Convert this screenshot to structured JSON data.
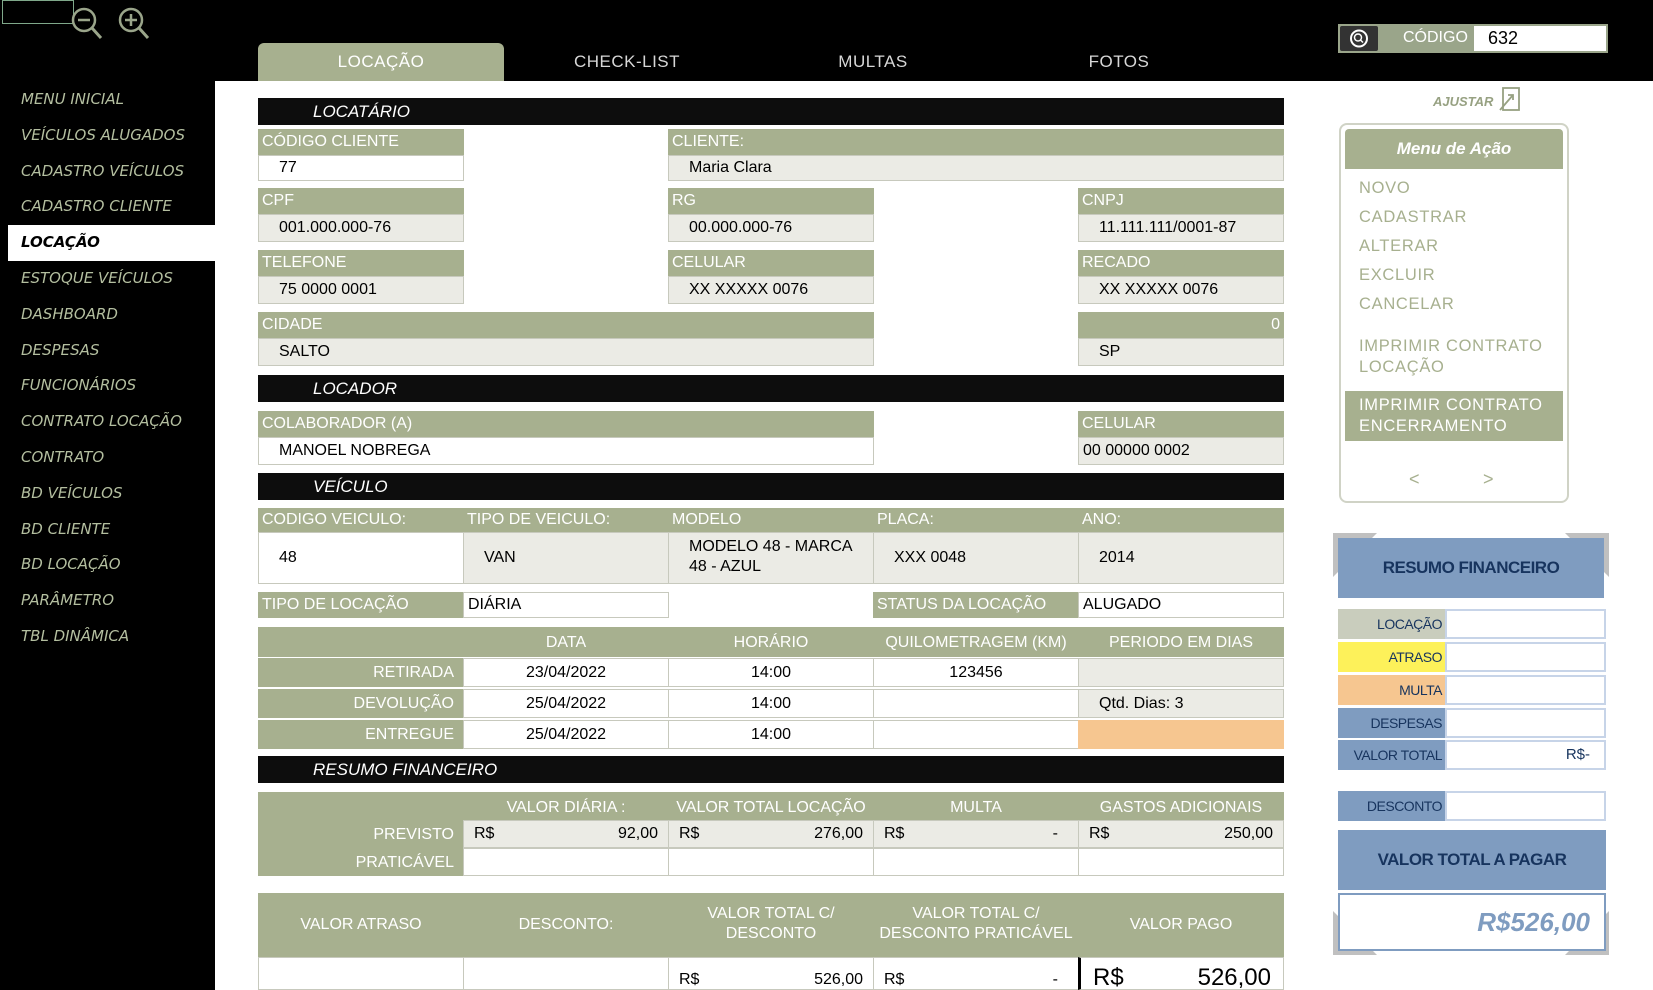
{
  "tabs": [
    {
      "label": "LOCAÇÃO",
      "active": true
    },
    {
      "label": "CHECK-LIST",
      "active": false
    },
    {
      "label": "MULTAS",
      "active": false
    },
    {
      "label": "FOTOS",
      "active": false
    }
  ],
  "sidebar": {
    "items": [
      {
        "label": "MENU INICIAL"
      },
      {
        "label": "VEÍCULOS ALUGADOS"
      },
      {
        "label": "CADASTRO VEÍCULOS"
      },
      {
        "label": "CADASTRO CLIENTE"
      },
      {
        "label": "LOCAÇÃO",
        "active": true
      },
      {
        "label": "ESTOQUE VEÍCULOS"
      },
      {
        "label": "DASHBOARD"
      },
      {
        "label": "DESPESAS"
      },
      {
        "label": "FUNCIONÁRIOS"
      },
      {
        "label": "CONTRATO LOCAÇÃO"
      },
      {
        "label": "CONTRATO"
      },
      {
        "label": "BD VEÍCULOS"
      },
      {
        "label": "BD CLIENTE"
      },
      {
        "label": "BD LOCAÇÃO"
      },
      {
        "label": "PARÂMETRO"
      },
      {
        "label": "TBL DINÂMICA"
      }
    ]
  },
  "search": {
    "label": "CÓDIGO",
    "value": "632",
    "icon": "search-icon"
  },
  "locatario": {
    "title": "LOCATÁRIO",
    "codigo_cliente_label": "CÓDIGO CLIENTE",
    "codigo_cliente": "77",
    "cliente_label": "CLIENTE:",
    "cliente": "Maria Clara",
    "cpf_label": "CPF",
    "cpf": "001.000.000-76",
    "rg_label": "RG",
    "rg": "00.000.000-76",
    "cnpj_label": "CNPJ",
    "cnpj": "11.111.111/0001-87",
    "telefone_label": "TELEFONE",
    "telefone": "75 0000 0001",
    "celular_label": "CELULAR",
    "celular": "XX XXXXX 0076",
    "recado_label": "RECADO",
    "recado": "XX XXXXX 0076",
    "cidade_label": "CIDADE",
    "cidade": "SALTO",
    "uf_code": "0",
    "uf": "SP"
  },
  "locador": {
    "title": "LOCADOR",
    "colaborador_label": "COLABORADOR (A)",
    "colaborador": "MANOEL NOBREGA",
    "celular_label": "CELULAR",
    "celular": "00 00000 0002"
  },
  "veiculo": {
    "title": "VEÍCULO",
    "codigo_label": "CODIGO VEICULO:",
    "codigo": "48",
    "tipo_label": "TIPO DE VEICULO:",
    "tipo": "VAN",
    "modelo_label": "MODELO",
    "modelo_line1": "MODELO 48 - MARCA",
    "modelo_line2": "48 - AZUL",
    "placa_label": "PLACA:",
    "placa": "XXX 0048",
    "ano_label": "ANO:",
    "ano": "2014",
    "tipo_locacao_label": "TIPO DE LOCAÇÃO",
    "tipo_locacao": "DIÁRIA",
    "status_label": "STATUS DA LOCAÇÃO",
    "status": "ALUGADO"
  },
  "agenda": {
    "headers": [
      "DATA",
      "HORÁRIO",
      "QUILOMETRAGEM (KM)",
      "PERIODO EM DIAS"
    ],
    "rows": [
      {
        "label": "RETIRADA",
        "data": "23/04/2022",
        "hora": "14:00",
        "km": "123456",
        "periodo": ""
      },
      {
        "label": "DEVOLUÇÃO",
        "data": "25/04/2022",
        "hora": "14:00",
        "km": "",
        "periodo": "Qtd. Dias: 3"
      },
      {
        "label": "ENTREGUE",
        "data": "25/04/2022",
        "hora": "14:00",
        "km": "",
        "periodo": ""
      }
    ]
  },
  "resumo": {
    "title": "RESUMO FINANCEIRO",
    "headers": [
      "VALOR DIÁRIA :",
      "VALOR TOTAL LOCAÇÃO",
      "MULTA",
      "GASTOS ADICIONAIS"
    ],
    "previsto_label": "PREVISTO",
    "praticavel_label": "PRATICÁVEL",
    "currency": "R$",
    "previsto": [
      "92,00",
      "276,00",
      "-",
      "250,00"
    ]
  },
  "totais": {
    "headers": [
      "VALOR ATRASO",
      "DESCONTO:",
      "VALOR TOTAL C/ DESCONTO",
      "VALOR TOTAL C/ DESCONTO PRATICÁVEL",
      "VALOR PAGO"
    ],
    "h3_line1": "VALOR TOTAL C/",
    "h3_line2": "DESCONTO",
    "h4_line1": "VALOR TOTAL C/",
    "h4_line2": "DESCONTO PRATICÁVEL",
    "valor_total_desconto": "526,00",
    "valor_total_praticavel": "-",
    "valor_pago": "526,00"
  },
  "right_panel": {
    "ajustar_label": "AJUSTAR",
    "menu_title": "Menu de Ação",
    "actions": [
      "NOVO",
      "CADASTRAR",
      "ALTERAR",
      "EXCLUIR",
      "CANCELAR"
    ],
    "imprimir_locacao_1": "IMPRIMIR  CONTRATO",
    "imprimir_locacao_2": "LOCAÇÃO",
    "imprimir_encerramento_1": "IMPRIMIR CONTRATO",
    "imprimir_encerramento_2": "ENCERRAMENTO",
    "prev": "<",
    "next": ">"
  },
  "resumo_panel": {
    "title": "RESUMO FINANCEIRO",
    "rows": [
      {
        "label": "LOCAÇÃO",
        "value": "",
        "color": "#c9cdbd"
      },
      {
        "label": "ATRASO",
        "value": "",
        "color": "#fdf15a"
      },
      {
        "label": "MULTA",
        "value": "",
        "color": "#f6c690"
      },
      {
        "label": "DESPESAS",
        "value": "",
        "color": "#7f9cc0"
      },
      {
        "label": "VALOR TOTAL",
        "value": "R$-",
        "color": "#7f9cc0"
      }
    ],
    "desconto_label": "DESCONTO",
    "desconto_value": "",
    "total_label": "VALOR TOTAL A PAGAR",
    "total_value": "R$526,00"
  },
  "colors": {
    "accent": "#a7b08f",
    "blue": "#7f9cc0",
    "orange": "#f6c690"
  }
}
